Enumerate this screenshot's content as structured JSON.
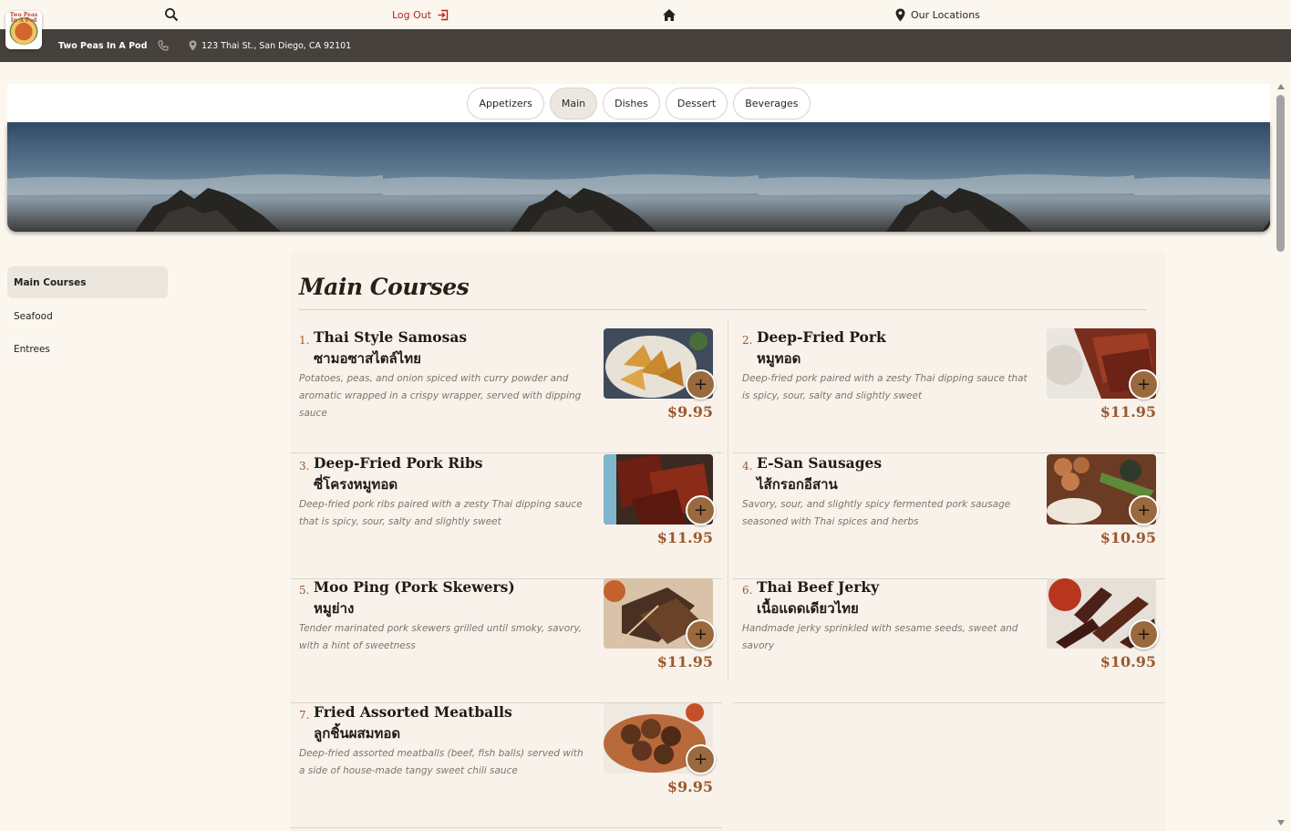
{
  "header": {
    "logout_label": "Log Out",
    "locations_label": "Our Locations",
    "logo_text": "Two Peas In A Pod",
    "icons": [
      "search-icon",
      "logout-icon",
      "home-icon",
      "location-pin-icon",
      "phone-icon"
    ]
  },
  "infobar": {
    "restaurant_name": "Two Peas In A Pod",
    "address": "123 Thai St., San Diego, CA 92101"
  },
  "tabs": [
    {
      "label": "Appetizers",
      "active": false
    },
    {
      "label": "Main",
      "active": true
    },
    {
      "label": "Dishes",
      "active": false
    },
    {
      "label": "Dessert",
      "active": false
    },
    {
      "label": "Beverages",
      "active": false
    }
  ],
  "sidebar": {
    "items": [
      {
        "label": "Main Courses",
        "active": true
      },
      {
        "label": "Seafood",
        "active": false
      },
      {
        "label": "Entrees",
        "active": false
      }
    ]
  },
  "menu": {
    "title": "Main Courses",
    "items": [
      {
        "num": "1.",
        "name": "Thai Style Samosas",
        "thai": "ซามอซาสไตล์ไทย",
        "desc": "Potatoes, peas, and onion spiced with curry powder and aromatic wrapped in a crispy wrapper, served with dipping sauce",
        "price": "$9.95",
        "add_label": "+"
      },
      {
        "num": "2.",
        "name": "Deep-Fried Pork",
        "thai": "หมูทอด",
        "desc": "Deep-fried pork paired with a zesty Thai dipping sauce that is spicy, sour, salty and slightly sweet",
        "price": "$11.95",
        "add_label": "+"
      },
      {
        "num": "3.",
        "name": "Deep-Fried Pork Ribs",
        "thai": "ซี่โครงหมูทอด",
        "desc": "Deep-fried pork ribs paired with a zesty Thai dipping sauce that is spicy, sour, salty and slightly sweet",
        "price": "$11.95",
        "add_label": "+"
      },
      {
        "num": "4.",
        "name": "E-San Sausages",
        "thai": "ไส้กรอกอีสาน",
        "desc": "Savory, sour, and slightly spicy fermented pork sausage seasoned with Thai spices and herbs",
        "price": "$10.95",
        "add_label": "+"
      },
      {
        "num": "5.",
        "name": "Moo Ping (Pork Skewers)",
        "thai": "หมูย่าง",
        "desc": "Tender marinated pork skewers grilled until smoky, savory, with a hint of sweetness",
        "price": "$11.95",
        "add_label": "+"
      },
      {
        "num": "6.",
        "name": "Thai Beef Jerky",
        "thai": "เนื้อแดดเดียวไทย",
        "desc": "Handmade jerky sprinkled with sesame seeds, sweet and savory",
        "price": "$10.95",
        "add_label": "+"
      },
      {
        "num": "7.",
        "name": "Fried Assorted Meatballs",
        "thai": "ลูกชิ้นผสมทอด",
        "desc": "Deep-fried assorted meatballs (beef, fish balls) served with a side of house-made tangy sweet chili sauce",
        "price": "$9.95",
        "add_label": "+"
      }
    ]
  },
  "colors": {
    "background": "#fbf6ee",
    "infobar": "#46413c",
    "accent": "#9a5a2f",
    "logout_text": "#b3261e",
    "add_button": "#9a6a3e"
  }
}
